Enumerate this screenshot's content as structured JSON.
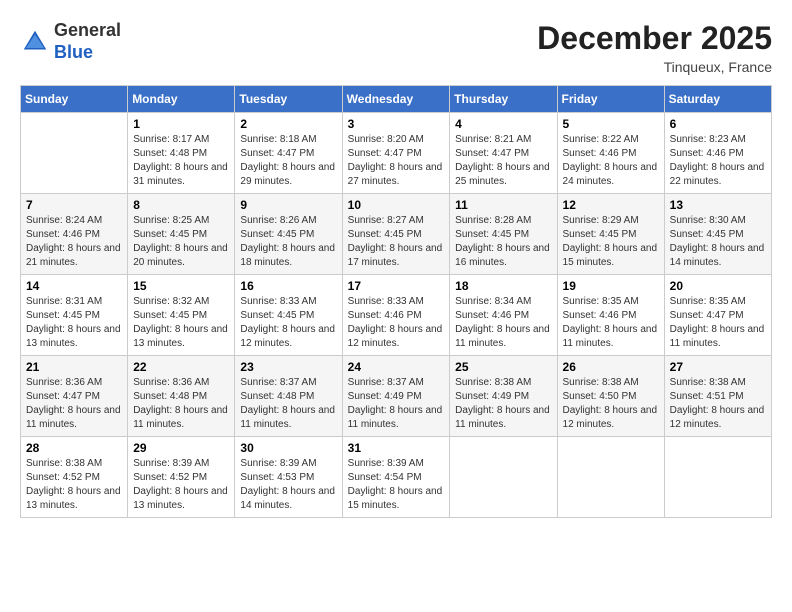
{
  "header": {
    "logo_line1": "General",
    "logo_line2": "Blue",
    "month": "December 2025",
    "location": "Tinqueux, France"
  },
  "weekdays": [
    "Sunday",
    "Monday",
    "Tuesday",
    "Wednesday",
    "Thursday",
    "Friday",
    "Saturday"
  ],
  "weeks": [
    [
      {
        "day": "",
        "sunrise": "",
        "sunset": "",
        "daylight": ""
      },
      {
        "day": "1",
        "sunrise": "Sunrise: 8:17 AM",
        "sunset": "Sunset: 4:48 PM",
        "daylight": "Daylight: 8 hours and 31 minutes."
      },
      {
        "day": "2",
        "sunrise": "Sunrise: 8:18 AM",
        "sunset": "Sunset: 4:47 PM",
        "daylight": "Daylight: 8 hours and 29 minutes."
      },
      {
        "day": "3",
        "sunrise": "Sunrise: 8:20 AM",
        "sunset": "Sunset: 4:47 PM",
        "daylight": "Daylight: 8 hours and 27 minutes."
      },
      {
        "day": "4",
        "sunrise": "Sunrise: 8:21 AM",
        "sunset": "Sunset: 4:47 PM",
        "daylight": "Daylight: 8 hours and 25 minutes."
      },
      {
        "day": "5",
        "sunrise": "Sunrise: 8:22 AM",
        "sunset": "Sunset: 4:46 PM",
        "daylight": "Daylight: 8 hours and 24 minutes."
      },
      {
        "day": "6",
        "sunrise": "Sunrise: 8:23 AM",
        "sunset": "Sunset: 4:46 PM",
        "daylight": "Daylight: 8 hours and 22 minutes."
      }
    ],
    [
      {
        "day": "7",
        "sunrise": "Sunrise: 8:24 AM",
        "sunset": "Sunset: 4:46 PM",
        "daylight": "Daylight: 8 hours and 21 minutes."
      },
      {
        "day": "8",
        "sunrise": "Sunrise: 8:25 AM",
        "sunset": "Sunset: 4:45 PM",
        "daylight": "Daylight: 8 hours and 20 minutes."
      },
      {
        "day": "9",
        "sunrise": "Sunrise: 8:26 AM",
        "sunset": "Sunset: 4:45 PM",
        "daylight": "Daylight: 8 hours and 18 minutes."
      },
      {
        "day": "10",
        "sunrise": "Sunrise: 8:27 AM",
        "sunset": "Sunset: 4:45 PM",
        "daylight": "Daylight: 8 hours and 17 minutes."
      },
      {
        "day": "11",
        "sunrise": "Sunrise: 8:28 AM",
        "sunset": "Sunset: 4:45 PM",
        "daylight": "Daylight: 8 hours and 16 minutes."
      },
      {
        "day": "12",
        "sunrise": "Sunrise: 8:29 AM",
        "sunset": "Sunset: 4:45 PM",
        "daylight": "Daylight: 8 hours and 15 minutes."
      },
      {
        "day": "13",
        "sunrise": "Sunrise: 8:30 AM",
        "sunset": "Sunset: 4:45 PM",
        "daylight": "Daylight: 8 hours and 14 minutes."
      }
    ],
    [
      {
        "day": "14",
        "sunrise": "Sunrise: 8:31 AM",
        "sunset": "Sunset: 4:45 PM",
        "daylight": "Daylight: 8 hours and 13 minutes."
      },
      {
        "day": "15",
        "sunrise": "Sunrise: 8:32 AM",
        "sunset": "Sunset: 4:45 PM",
        "daylight": "Daylight: 8 hours and 13 minutes."
      },
      {
        "day": "16",
        "sunrise": "Sunrise: 8:33 AM",
        "sunset": "Sunset: 4:45 PM",
        "daylight": "Daylight: 8 hours and 12 minutes."
      },
      {
        "day": "17",
        "sunrise": "Sunrise: 8:33 AM",
        "sunset": "Sunset: 4:46 PM",
        "daylight": "Daylight: 8 hours and 12 minutes."
      },
      {
        "day": "18",
        "sunrise": "Sunrise: 8:34 AM",
        "sunset": "Sunset: 4:46 PM",
        "daylight": "Daylight: 8 hours and 11 minutes."
      },
      {
        "day": "19",
        "sunrise": "Sunrise: 8:35 AM",
        "sunset": "Sunset: 4:46 PM",
        "daylight": "Daylight: 8 hours and 11 minutes."
      },
      {
        "day": "20",
        "sunrise": "Sunrise: 8:35 AM",
        "sunset": "Sunset: 4:47 PM",
        "daylight": "Daylight: 8 hours and 11 minutes."
      }
    ],
    [
      {
        "day": "21",
        "sunrise": "Sunrise: 8:36 AM",
        "sunset": "Sunset: 4:47 PM",
        "daylight": "Daylight: 8 hours and 11 minutes."
      },
      {
        "day": "22",
        "sunrise": "Sunrise: 8:36 AM",
        "sunset": "Sunset: 4:48 PM",
        "daylight": "Daylight: 8 hours and 11 minutes."
      },
      {
        "day": "23",
        "sunrise": "Sunrise: 8:37 AM",
        "sunset": "Sunset: 4:48 PM",
        "daylight": "Daylight: 8 hours and 11 minutes."
      },
      {
        "day": "24",
        "sunrise": "Sunrise: 8:37 AM",
        "sunset": "Sunset: 4:49 PM",
        "daylight": "Daylight: 8 hours and 11 minutes."
      },
      {
        "day": "25",
        "sunrise": "Sunrise: 8:38 AM",
        "sunset": "Sunset: 4:49 PM",
        "daylight": "Daylight: 8 hours and 11 minutes."
      },
      {
        "day": "26",
        "sunrise": "Sunrise: 8:38 AM",
        "sunset": "Sunset: 4:50 PM",
        "daylight": "Daylight: 8 hours and 12 minutes."
      },
      {
        "day": "27",
        "sunrise": "Sunrise: 8:38 AM",
        "sunset": "Sunset: 4:51 PM",
        "daylight": "Daylight: 8 hours and 12 minutes."
      }
    ],
    [
      {
        "day": "28",
        "sunrise": "Sunrise: 8:38 AM",
        "sunset": "Sunset: 4:52 PM",
        "daylight": "Daylight: 8 hours and 13 minutes."
      },
      {
        "day": "29",
        "sunrise": "Sunrise: 8:39 AM",
        "sunset": "Sunset: 4:52 PM",
        "daylight": "Daylight: 8 hours and 13 minutes."
      },
      {
        "day": "30",
        "sunrise": "Sunrise: 8:39 AM",
        "sunset": "Sunset: 4:53 PM",
        "daylight": "Daylight: 8 hours and 14 minutes."
      },
      {
        "day": "31",
        "sunrise": "Sunrise: 8:39 AM",
        "sunset": "Sunset: 4:54 PM",
        "daylight": "Daylight: 8 hours and 15 minutes."
      },
      {
        "day": "",
        "sunrise": "",
        "sunset": "",
        "daylight": ""
      },
      {
        "day": "",
        "sunrise": "",
        "sunset": "",
        "daylight": ""
      },
      {
        "day": "",
        "sunrise": "",
        "sunset": "",
        "daylight": ""
      }
    ]
  ]
}
